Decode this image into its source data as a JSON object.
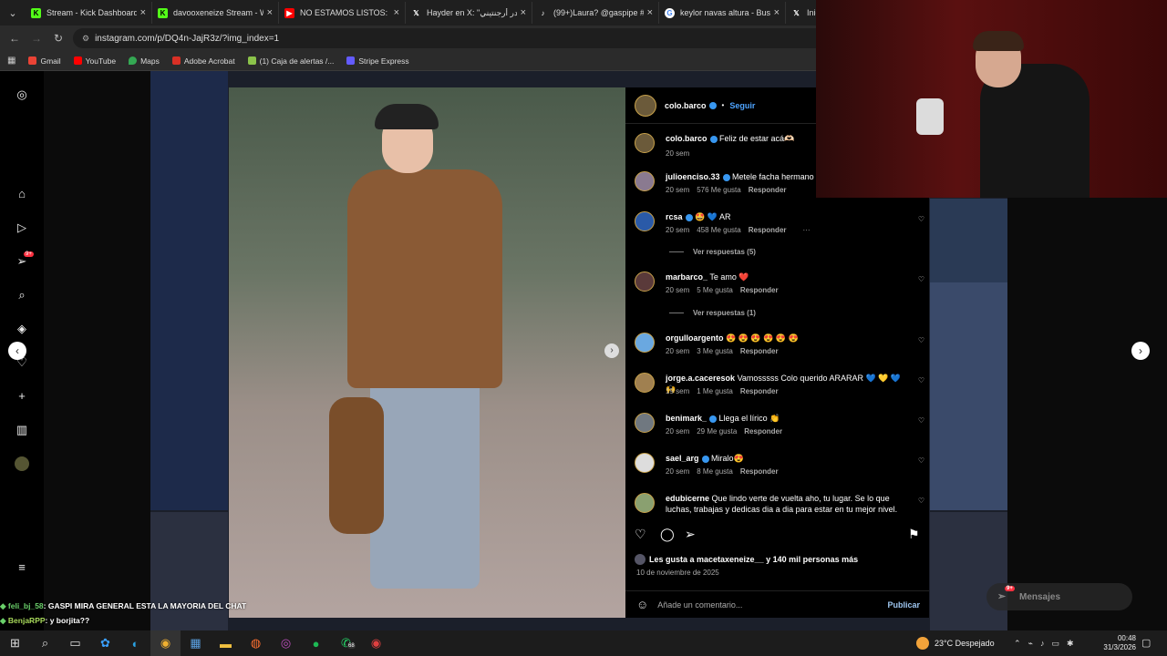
{
  "tabs": [
    {
      "title": "Stream - Kick Dashboard",
      "icon": "kick-icon",
      "color": "#53fc18"
    },
    {
      "title": "davooxeneize Stream - W",
      "icon": "kick-icon",
      "color": "#53fc18"
    },
    {
      "title": "NO ESTAMOS LISTOS: ¿Po",
      "icon": "youtube-icon",
      "color": "#ff0000"
    },
    {
      "title": "Hayder en X: \"هيدر أرجنتيني",
      "icon": "x-icon",
      "color": "#ffffff"
    },
    {
      "title": "(99+)Laura? @gaspipe #",
      "icon": "tiktok-icon",
      "color": "#ffffff"
    },
    {
      "title": "keylor navas altura - Busc",
      "icon": "google-icon",
      "color": "#4285f4"
    },
    {
      "title": "Inici",
      "icon": "x-icon",
      "color": "#ffffff"
    }
  ],
  "address": {
    "url": "instagram.com/p/DQ4n-JajR3z/?img_index=1"
  },
  "bookmarks": [
    {
      "label": "Gmail",
      "color": "#ea4335"
    },
    {
      "label": "YouTube",
      "color": "#ff0000"
    },
    {
      "label": "Maps",
      "color": "#34a853"
    },
    {
      "label": "Adobe Acrobat",
      "color": "#d93025"
    },
    {
      "label": "(1) Caja de alertas /...",
      "color": "#8bc34a"
    },
    {
      "label": "Stripe Express",
      "color": "#635bff"
    }
  ],
  "sidebar": {
    "notif_badge": "9+"
  },
  "post": {
    "author": "colo.barco",
    "follow": "Seguir",
    "comments": [
      {
        "user": "colo.barco",
        "text": "Feliz de estar acá🫶🏻",
        "time": "20 sem",
        "likes": "",
        "reply": ""
      },
      {
        "user": "julioenciso.33",
        "text": "Metele facha hermano",
        "time": "20 sem",
        "likes": "576 Me gusta",
        "reply": "Responder"
      },
      {
        "user": "rcsa",
        "text": "🤩 💙 AR",
        "time": "20 sem",
        "likes": "458 Me gusta",
        "reply": "Responder",
        "more": "···"
      },
      {
        "user": "marbarco_",
        "text": "Te amo ❤️",
        "time": "20 sem",
        "likes": "5 Me gusta",
        "reply": "Responder"
      },
      {
        "user": "orgulloargento",
        "text": "😍 😍 😍 😍 😍 😍",
        "time": "20 sem",
        "likes": "3 Me gusta",
        "reply": "Responder"
      },
      {
        "user": "jorge.a.caceresok",
        "text": "Vamosssss Colo querido ARARAR 💙 💛 💙 🙌",
        "time": "19 sem",
        "likes": "1 Me gusta",
        "reply": "Responder"
      },
      {
        "user": "benimark_",
        "text": "Llega el lírico 👏",
        "time": "20 sem",
        "likes": "29 Me gusta",
        "reply": "Responder"
      },
      {
        "user": "sael_arg",
        "text": "Miralo😍",
        "time": "20 sem",
        "likes": "8 Me gusta",
        "reply": "Responder"
      },
      {
        "user": "edubicerne",
        "text": "Que lindo verte de vuelta aho, tu lugar. Se lo que luchas, trabajas y dedicas dia a dia para estar en tu mejor nivel.",
        "time": "",
        "likes": "",
        "reply": ""
      }
    ],
    "view_replies": [
      "Ver respuestas (5)",
      "Ver respuestas (1)"
    ],
    "likes_text": "Les gusta a macetaxeneize__ y 140 mil personas más",
    "date": "10 de noviembre de 2025",
    "add_comment": "Añade un comentario...",
    "publish": "Publicar"
  },
  "messages": {
    "label": "Mensajes",
    "badge": "9+"
  },
  "chat": [
    {
      "user": "feli_bj_58",
      "text": ": GASPI MIRA GENERAL ESTA LA MAYORIA DEL CHAT"
    },
    {
      "user": "BenjaRPP",
      "text": ": y borjita??"
    }
  ],
  "taskbar": {
    "whatsapp_badge": "68",
    "weather": "23°C  Despejado",
    "time": "00:48",
    "date": "31/3/2026"
  }
}
